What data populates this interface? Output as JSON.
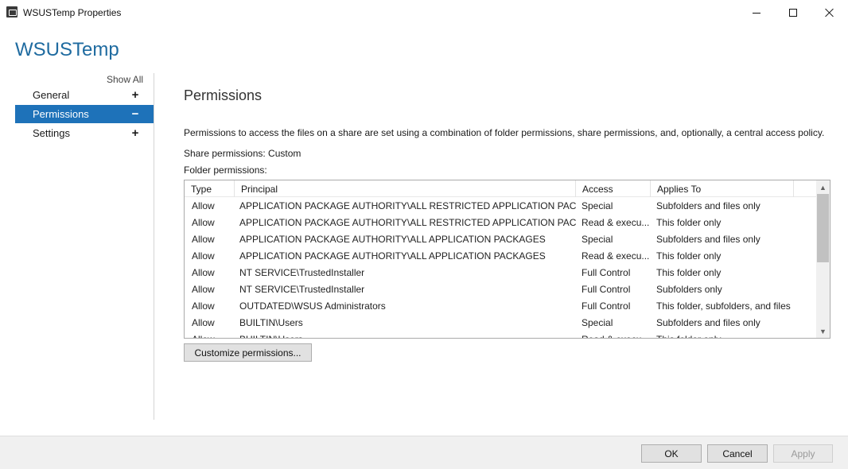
{
  "window": {
    "title": "WSUSTemp Properties",
    "minimize_label": "Minimize",
    "maximize_label": "Maximize",
    "close_label": "Close"
  },
  "heading": "WSUSTemp",
  "sidebar": {
    "show_all": "Show All",
    "items": [
      {
        "label": "General",
        "sign": "+",
        "selected": false
      },
      {
        "label": "Permissions",
        "sign": "−",
        "selected": true
      },
      {
        "label": "Settings",
        "sign": "+",
        "selected": false
      }
    ],
    "selected_color": "#1e72b9"
  },
  "main": {
    "section_title": "Permissions",
    "description": "Permissions to access the files on a share are set using a combination of folder permissions, share permissions, and, optionally, a central access policy.",
    "share_permissions": "Share permissions: Custom",
    "folder_permissions_label": "Folder permissions:",
    "columns": [
      "Type",
      "Principal",
      "Access",
      "Applies To"
    ],
    "rows": [
      {
        "type": "Allow",
        "principal": "APPLICATION PACKAGE AUTHORITY\\ALL RESTRICTED APPLICATION PACKAGES",
        "access": "Special",
        "applies_to": "Subfolders and files only"
      },
      {
        "type": "Allow",
        "principal": "APPLICATION PACKAGE AUTHORITY\\ALL RESTRICTED APPLICATION PACKAGES",
        "access": "Read & execu...",
        "applies_to": "This folder only"
      },
      {
        "type": "Allow",
        "principal": "APPLICATION PACKAGE AUTHORITY\\ALL APPLICATION PACKAGES",
        "access": "Special",
        "applies_to": "Subfolders and files only"
      },
      {
        "type": "Allow",
        "principal": "APPLICATION PACKAGE AUTHORITY\\ALL APPLICATION PACKAGES",
        "access": "Read & execu...",
        "applies_to": "This folder only"
      },
      {
        "type": "Allow",
        "principal": "NT SERVICE\\TrustedInstaller",
        "access": "Full Control",
        "applies_to": "This folder only"
      },
      {
        "type": "Allow",
        "principal": "NT SERVICE\\TrustedInstaller",
        "access": "Full Control",
        "applies_to": "Subfolders only"
      },
      {
        "type": "Allow",
        "principal": "OUTDATED\\WSUS Administrators",
        "access": "Full Control",
        "applies_to": "This folder, subfolders, and files"
      },
      {
        "type": "Allow",
        "principal": "BUILTIN\\Users",
        "access": "Special",
        "applies_to": "Subfolders and files only"
      },
      {
        "type": "Allow",
        "principal": "BUILTIN\\Users",
        "access": "Read & execu...",
        "applies_to": "This folder only"
      }
    ],
    "customize_button": "Customize permissions..."
  },
  "footer": {
    "ok": "OK",
    "cancel": "Cancel",
    "apply": "Apply"
  }
}
